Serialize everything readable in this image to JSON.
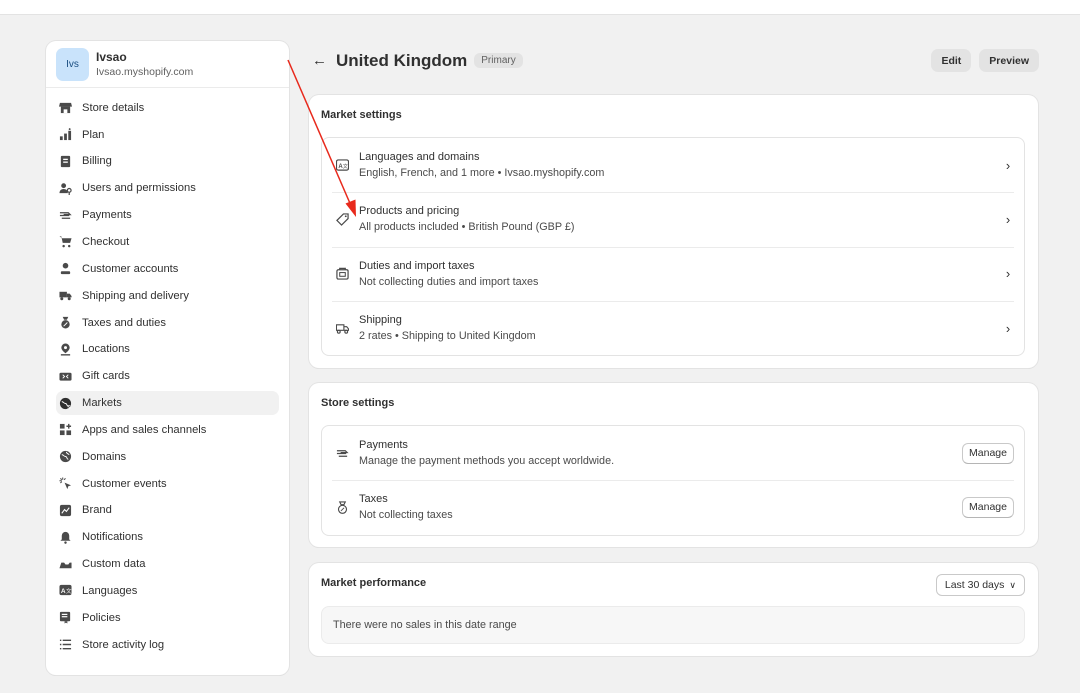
{
  "store": {
    "avatar_text": "Ivs",
    "name": "Ivsao",
    "domain": "Ivsao.myshopify.com"
  },
  "sidebar": {
    "items": [
      {
        "label": "Store details",
        "icon": "store-icon"
      },
      {
        "label": "Plan",
        "icon": "plan-chart-icon"
      },
      {
        "label": "Billing",
        "icon": "receipt-icon"
      },
      {
        "label": "Users and permissions",
        "icon": "users-icon"
      },
      {
        "label": "Payments",
        "icon": "payments-icon"
      },
      {
        "label": "Checkout",
        "icon": "cart-icon"
      },
      {
        "label": "Customer accounts",
        "icon": "person-icon"
      },
      {
        "label": "Shipping and delivery",
        "icon": "truck-icon"
      },
      {
        "label": "Taxes and duties",
        "icon": "tax-bag-icon"
      },
      {
        "label": "Locations",
        "icon": "location-pin-icon"
      },
      {
        "label": "Gift cards",
        "icon": "gift-card-icon"
      },
      {
        "label": "Markets",
        "icon": "globe-market-icon",
        "active": true
      },
      {
        "label": "Apps and sales channels",
        "icon": "apps-icon"
      },
      {
        "label": "Domains",
        "icon": "globe-icon"
      },
      {
        "label": "Customer events",
        "icon": "cursor-click-icon"
      },
      {
        "label": "Brand",
        "icon": "brand-icon"
      },
      {
        "label": "Notifications",
        "icon": "bell-icon"
      },
      {
        "label": "Custom data",
        "icon": "data-icon"
      },
      {
        "label": "Languages",
        "icon": "language-icon"
      },
      {
        "label": "Policies",
        "icon": "policy-icon"
      },
      {
        "label": "Store activity log",
        "icon": "list-icon"
      }
    ]
  },
  "header": {
    "back_icon": "arrow-left-icon",
    "title": "United Kingdom",
    "badge": "Primary",
    "edit_label": "Edit",
    "preview_label": "Preview"
  },
  "market_settings": {
    "title": "Market settings",
    "rows": [
      {
        "title": "Languages and domains",
        "subtitle": "English, French, and 1 more • Ivsao.myshopify.com",
        "icon": "language-icon"
      },
      {
        "title": "Products and pricing",
        "subtitle": "All products included • British Pound (GBP £)",
        "icon": "price-tag-icon"
      },
      {
        "title": "Duties and import taxes",
        "subtitle": "Not collecting duties and import taxes",
        "icon": "duties-icon"
      },
      {
        "title": "Shipping",
        "subtitle": "2 rates • Shipping to United Kingdom",
        "icon": "truck-icon"
      }
    ]
  },
  "store_settings": {
    "title": "Store settings",
    "rows": [
      {
        "title": "Payments",
        "subtitle": "Manage the payment methods you accept worldwide.",
        "button": "Manage",
        "icon": "payments-icon"
      },
      {
        "title": "Taxes",
        "subtitle": "Not collecting taxes",
        "button": "Manage",
        "icon": "tax-bag-icon"
      }
    ]
  },
  "market_performance": {
    "title": "Market performance",
    "date_range": "Last 30 days",
    "empty_message": "There were no sales in this date range"
  },
  "annotation": {
    "color": "#e8291c"
  }
}
